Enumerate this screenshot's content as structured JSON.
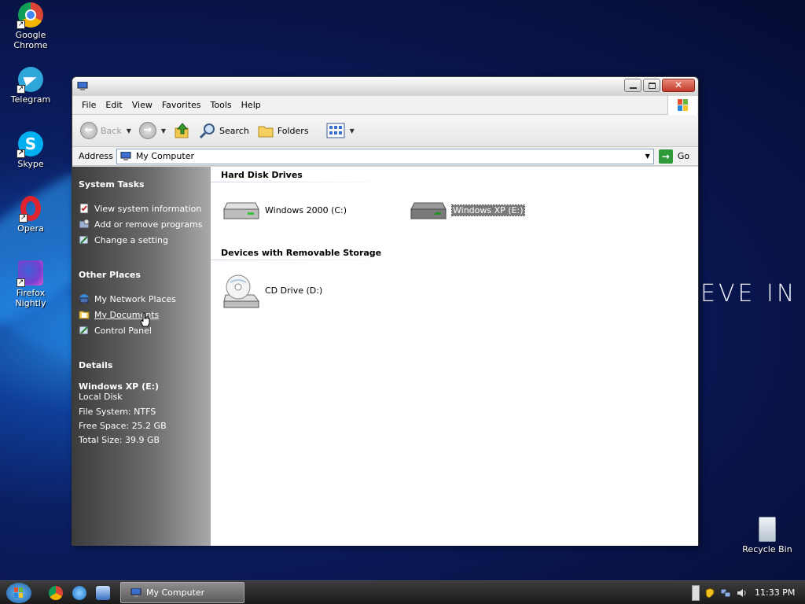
{
  "desktop": {
    "icons": [
      {
        "label_line1": "Google",
        "label_line2": "Chrome"
      },
      {
        "label_line1": "Telegram",
        "label_line2": ""
      },
      {
        "label_line1": "Skype",
        "label_line2": ""
      },
      {
        "label_line1": "Opera",
        "label_line2": ""
      },
      {
        "label_line1": "Firefox",
        "label_line2": "Nightly"
      },
      {
        "label_line1": "Recycle Bin",
        "label_line2": ""
      }
    ],
    "wallpaper_text": "EVE IN"
  },
  "window": {
    "menu": [
      "File",
      "Edit",
      "View",
      "Favorites",
      "Tools",
      "Help"
    ],
    "toolbar": {
      "back": "Back",
      "search": "Search",
      "folders": "Folders"
    },
    "address": {
      "label": "Address",
      "value": "My Computer",
      "go": "Go"
    },
    "taskpane": {
      "system_tasks": {
        "title": "System Tasks",
        "items": [
          "View system information",
          "Add or remove programs",
          "Change a setting"
        ]
      },
      "other_places": {
        "title": "Other Places",
        "items": [
          "My Network Places",
          "My Documents",
          "Control Panel"
        ]
      },
      "details": {
        "title": "Details",
        "name": "Windows XP (E:)",
        "type": "Local Disk",
        "filesystem": "File System: NTFS",
        "free": "Free Space: 25.2 GB",
        "total": "Total Size: 39.9 GB"
      }
    },
    "content": {
      "hard_disk_group": "Hard Disk Drives",
      "drives": [
        "Windows 2000 (C:)",
        "Windows XP (E:)"
      ],
      "removable_group": "Devices with Removable Storage",
      "removable": [
        "CD Drive (D:)"
      ]
    }
  },
  "taskbar": {
    "task_label": "My Computer",
    "clock": "11:33 PM"
  },
  "colors": {
    "accent": "#0b1f63",
    "selection": "#7b7b7b"
  }
}
